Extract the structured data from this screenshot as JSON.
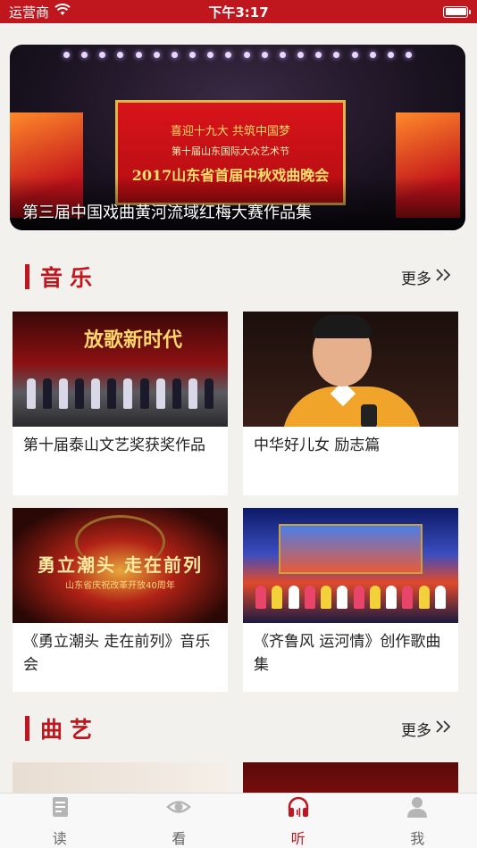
{
  "status_bar": {
    "carrier": "运营商",
    "time": "下午3:17",
    "wifi_icon": "wifi-icon",
    "battery_level": 1.0
  },
  "banner": {
    "caption": "第三届中国戏曲黄河流域红梅大赛作品集",
    "screen_line1": "喜迎十九大 共筑中国梦",
    "screen_line2": "第十届山东国际大众艺术节",
    "screen_line3": "2017山东省首届中秋戏曲晚会"
  },
  "sections": [
    {
      "title": "音乐",
      "more_label": "更多",
      "more_icon": "double-chevron-right-icon",
      "cards": [
        {
          "title": "第十届泰山文艺奖获奖作品",
          "thumb_text": "放歌新时代"
        },
        {
          "title": "中华好儿女 励志篇"
        },
        {
          "title": "《勇立潮头 走在前列》音乐会",
          "thumb_text": "勇立潮头 走在前列",
          "thumb_sub": "山东省庆祝改革开放40周年"
        },
        {
          "title": "《齐鲁风 运河情》创作歌曲集"
        }
      ]
    },
    {
      "title": "曲艺",
      "more_label": "更多",
      "more_icon": "double-chevron-right-icon",
      "cards": []
    }
  ],
  "tab_bar": {
    "active": "听",
    "items": [
      {
        "label": "读",
        "icon": "book-icon"
      },
      {
        "label": "看",
        "icon": "eye-icon"
      },
      {
        "label": "听",
        "icon": "headphones-icon"
      },
      {
        "label": "我",
        "icon": "person-icon"
      }
    ]
  },
  "colors": {
    "brand_red": "#c0171e",
    "background": "#f3f1ee",
    "tab_inactive": "#999999"
  }
}
